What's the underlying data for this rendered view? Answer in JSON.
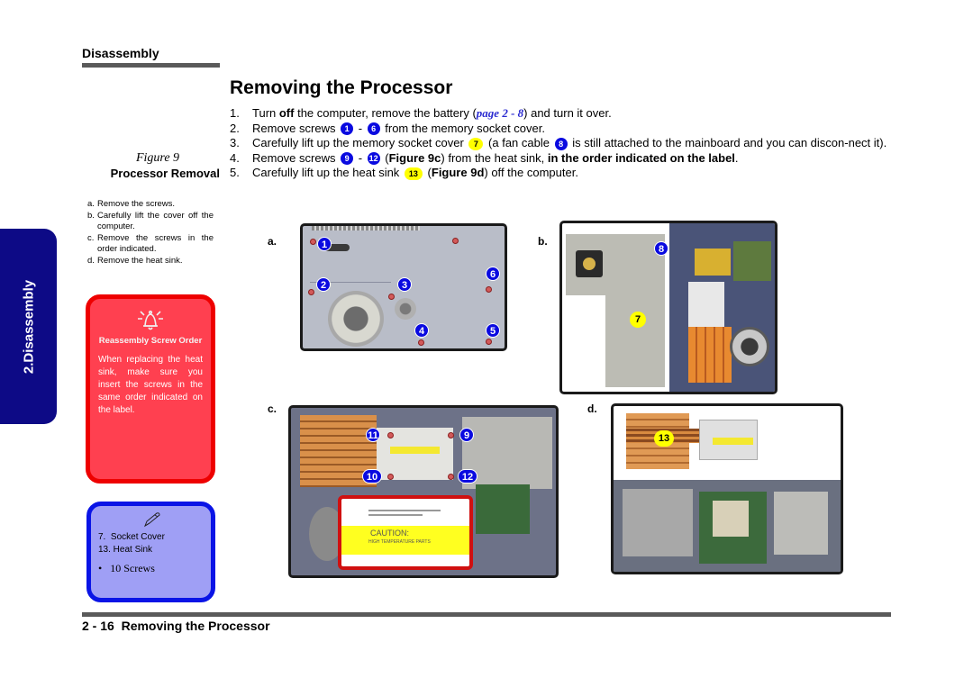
{
  "header": {
    "section": "Disassembly"
  },
  "page_title": "Removing the Processor",
  "steps": [
    {
      "num": "1.",
      "parts": {
        "a": "Turn ",
        "b": "off",
        "c": " the computer, remove the battery (",
        "link": "page 2 - 8",
        "d": ") and turn it over."
      }
    },
    {
      "num": "2.",
      "parts": {
        "a": "Remove screws ",
        "badge1": "1",
        "sep": " - ",
        "badge2": "6",
        "b": " from the memory socket cover."
      }
    },
    {
      "num": "3.",
      "parts": {
        "a": "Carefully lift up the memory socket cover ",
        "badge1": "7",
        "b": " (a fan cable ",
        "badge2": "8",
        "c": " is still attached to the mainboard and you can discon-nect it)."
      }
    },
    {
      "num": "4.",
      "parts": {
        "a": "Remove screws ",
        "badge1": "9",
        "sep": " - ",
        "badge2": "12",
        "b": " (",
        "bold1": "Figure 9c",
        "c": ") from the heat sink, ",
        "bold2": "in the order indicated on the label",
        "d": "."
      }
    },
    {
      "num": "5.",
      "parts": {
        "a": "Carefully lift up the heat sink ",
        "badge1": "13",
        "b": " (",
        "bold1": "Figure 9d",
        "c": ") off the computer."
      }
    }
  ],
  "figure": {
    "number": "Figure 9",
    "title": "Processor Removal",
    "notes": [
      {
        "letter": "a.",
        "text": "Remove the screws."
      },
      {
        "letter": "b.",
        "text": "Carefully lift the cover off the computer."
      },
      {
        "letter": "c.",
        "text": "Remove the screws in the order indicated."
      },
      {
        "letter": "d.",
        "text": "Remove the heat sink."
      }
    ],
    "panels": [
      {
        "letter": "a.",
        "pins": [
          "1",
          "2",
          "3",
          "4",
          "5",
          "6"
        ]
      },
      {
        "letter": "b.",
        "pins": [
          "7",
          "8"
        ]
      },
      {
        "letter": "c.",
        "pins": [
          "9",
          "10",
          "11",
          "12"
        ],
        "label": {
          "caution": "CAUTION:",
          "line": "HIGH TEMPERATURE PARTS"
        }
      },
      {
        "letter": "d.",
        "pins": [
          "13"
        ]
      }
    ]
  },
  "side_tab": {
    "label": "2.Disassembly",
    "color": "#0d0a86"
  },
  "warning": {
    "icon": "bell-alert-icon",
    "title": "Reassembly Screw Order",
    "body": "When replacing the heat sink, make sure you insert the screws in the same order indicated on the label.",
    "color": "#ff4050"
  },
  "note": {
    "icon": "pen-icon",
    "lines": [
      "7.  Socket Cover",
      "13. Heat Sink"
    ],
    "bullet": "•   10 Screws",
    "color": "#9f9ff5"
  },
  "footer": {
    "text": "2 - 16  Removing the Processor"
  }
}
